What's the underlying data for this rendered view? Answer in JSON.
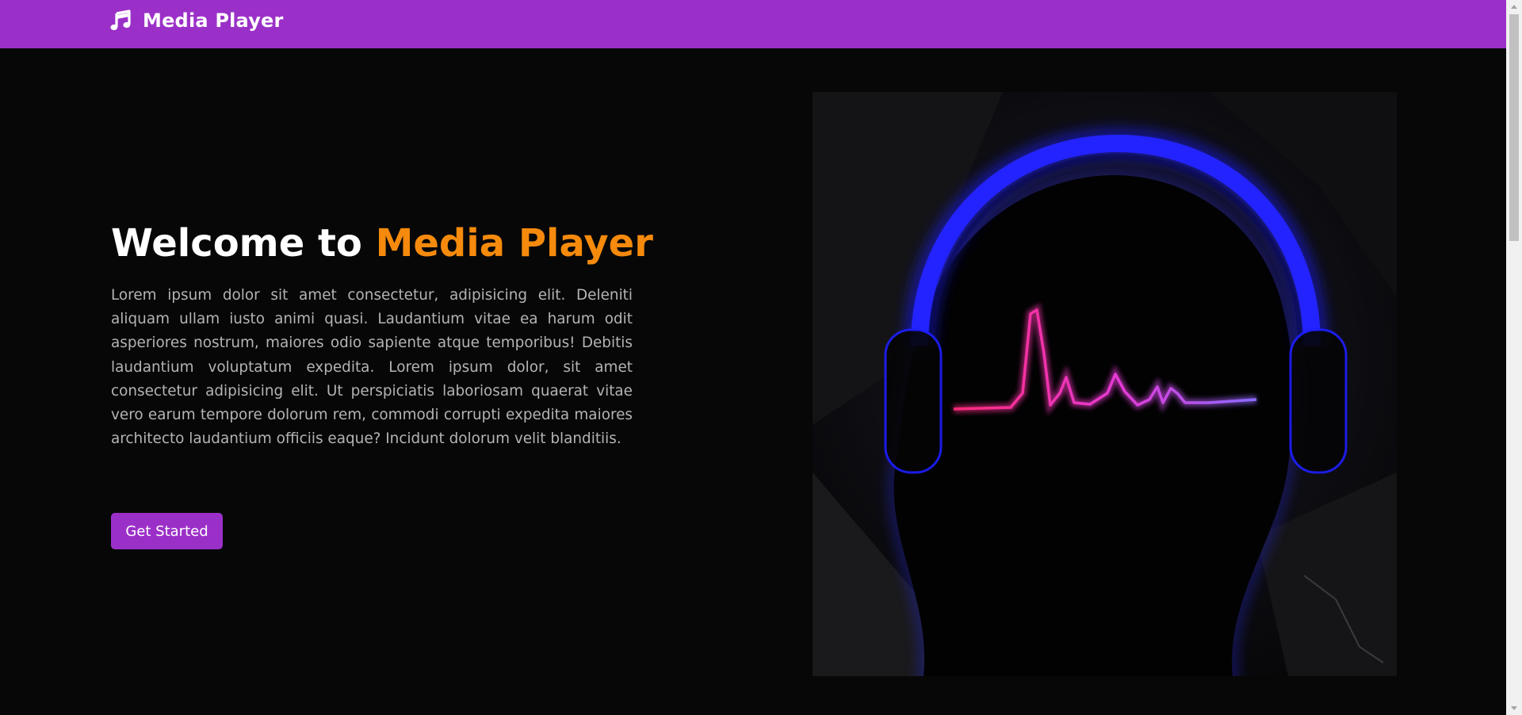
{
  "navbar": {
    "brand_icon": "music-note-icon",
    "brand_label": "Media Player",
    "background_color": "#9b30c8"
  },
  "hero": {
    "title_prefix": "Welcome to ",
    "title_accent": "Media Player",
    "accent_color": "#f58a0d",
    "body": "Lorem ipsum dolor sit amet consectetur, adipisicing elit. Deleniti aliquam ullam iusto animi quasi. Laudantium vitae ea harum odit asperiores nostrum, maiores odio sapiente atque temporibus! Debitis laudantium voluptatum expedita. Lorem ipsum dolor, sit amet consectetur adipisicing elit. Ut perspiciatis laboriosam quaerat vitae vero earum tempore dolorum rem, commodi corrupti expedita maiores architecto laudantium officiis eaque? Incidunt dolorum velit blanditiis.",
    "cta_label": "Get Started",
    "image_icon": "headphones-heartbeat-illustration"
  }
}
